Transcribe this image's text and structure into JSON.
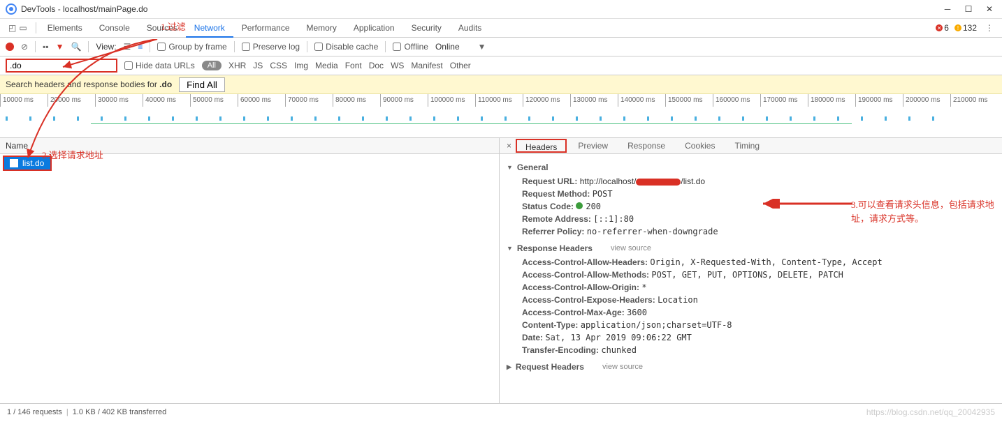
{
  "titlebar": {
    "title": "DevTools - localhost/mainPage.do"
  },
  "maintabs": {
    "items": [
      "Elements",
      "Console",
      "Sources",
      "Network",
      "Performance",
      "Memory",
      "Application",
      "Security",
      "Audits"
    ],
    "active": 3,
    "errors": "6",
    "warnings": "132"
  },
  "toolbar": {
    "view_label": "View:",
    "group_by_frame": "Group by frame",
    "preserve_log": "Preserve log",
    "disable_cache": "Disable cache",
    "offline": "Offline",
    "throttle": "Online"
  },
  "filterbar": {
    "filter_value": ".do",
    "hide_data_urls": "Hide data URLs",
    "all": "All",
    "types": [
      "XHR",
      "JS",
      "CSS",
      "Img",
      "Media",
      "Font",
      "Doc",
      "WS",
      "Manifest",
      "Other"
    ]
  },
  "searchbar": {
    "text_pre": "Search headers and response bodies for ",
    "text_term": ".do",
    "find_all": "Find All"
  },
  "timeline": {
    "labels": [
      "10000 ms",
      "20000 ms",
      "30000 ms",
      "40000 ms",
      "50000 ms",
      "60000 ms",
      "70000 ms",
      "80000 ms",
      "90000 ms",
      "100000 ms",
      "110000 ms",
      "120000 ms",
      "130000 ms",
      "140000 ms",
      "150000 ms",
      "160000 ms",
      "170000 ms",
      "180000 ms",
      "190000 ms",
      "200000 ms",
      "210000 ms"
    ]
  },
  "leftpane": {
    "header": "Name",
    "rows": [
      {
        "name": "list.do"
      }
    ]
  },
  "rightpane": {
    "tabs": [
      "Headers",
      "Preview",
      "Response",
      "Cookies",
      "Timing"
    ],
    "active": 0,
    "general": {
      "title": "General",
      "request_url_label": "Request URL:",
      "request_url_pre": "http://localhost/",
      "request_url_post": "/list.do",
      "request_method_label": "Request Method:",
      "request_method": "POST",
      "status_code_label": "Status Code:",
      "status_code": "200",
      "remote_address_label": "Remote Address:",
      "remote_address": "[::1]:80",
      "referrer_policy_label": "Referrer Policy:",
      "referrer_policy": "no-referrer-when-downgrade"
    },
    "response_headers": {
      "title": "Response Headers",
      "view_source": "view source",
      "items": [
        {
          "k": "Access-Control-Allow-Headers:",
          "v": "Origin, X-Requested-With, Content-Type, Accept"
        },
        {
          "k": "Access-Control-Allow-Methods:",
          "v": "POST, GET, PUT, OPTIONS, DELETE, PATCH"
        },
        {
          "k": "Access-Control-Allow-Origin:",
          "v": "*"
        },
        {
          "k": "Access-Control-Expose-Headers:",
          "v": "Location"
        },
        {
          "k": "Access-Control-Max-Age:",
          "v": "3600"
        },
        {
          "k": "Content-Type:",
          "v": "application/json;charset=UTF-8"
        },
        {
          "k": "Date:",
          "v": "Sat, 13 Apr 2019 09:06:22 GMT"
        },
        {
          "k": "Transfer-Encoding:",
          "v": "chunked"
        }
      ]
    },
    "request_headers": {
      "title": "Request Headers",
      "view_source": "view source"
    }
  },
  "statusbar": {
    "requests": "1 / 146 requests",
    "transferred": "1.0 KB / 402 KB transferred",
    "watermark": "https://blog.csdn.net/qq_20042935"
  },
  "annotations": {
    "a1": "1.过滤",
    "a2": "2.选择请求地址",
    "a3": "3.可以查看请求头信息，包括请求地址，请求方式等。"
  }
}
